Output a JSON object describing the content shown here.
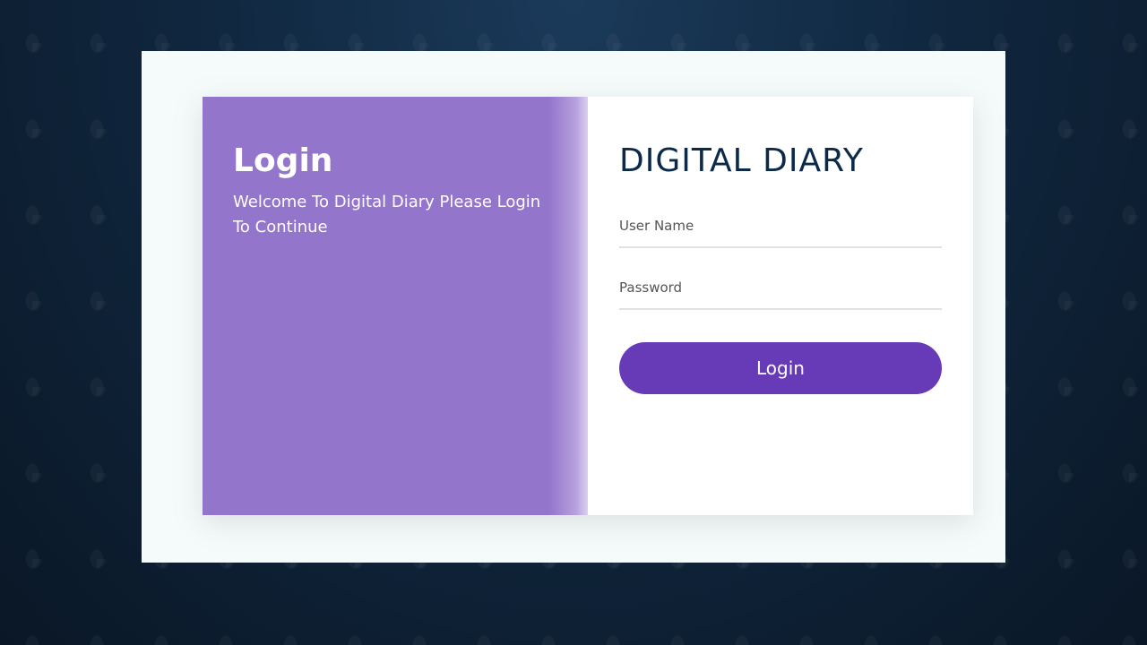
{
  "left_panel": {
    "title": "Login",
    "subtitle": "Welcome To Digital Diary Please Login To Continue"
  },
  "form": {
    "app_title": "DIGITAL DIARY",
    "username": {
      "placeholder": "User Name",
      "value": ""
    },
    "password": {
      "placeholder": "Password",
      "value": ""
    },
    "submit_label": "Login"
  },
  "colors": {
    "left_panel_bg": "#9475cc",
    "button_bg": "#673ab7",
    "title_color": "#0b2a4a",
    "slide_bg": "#0f2236"
  }
}
